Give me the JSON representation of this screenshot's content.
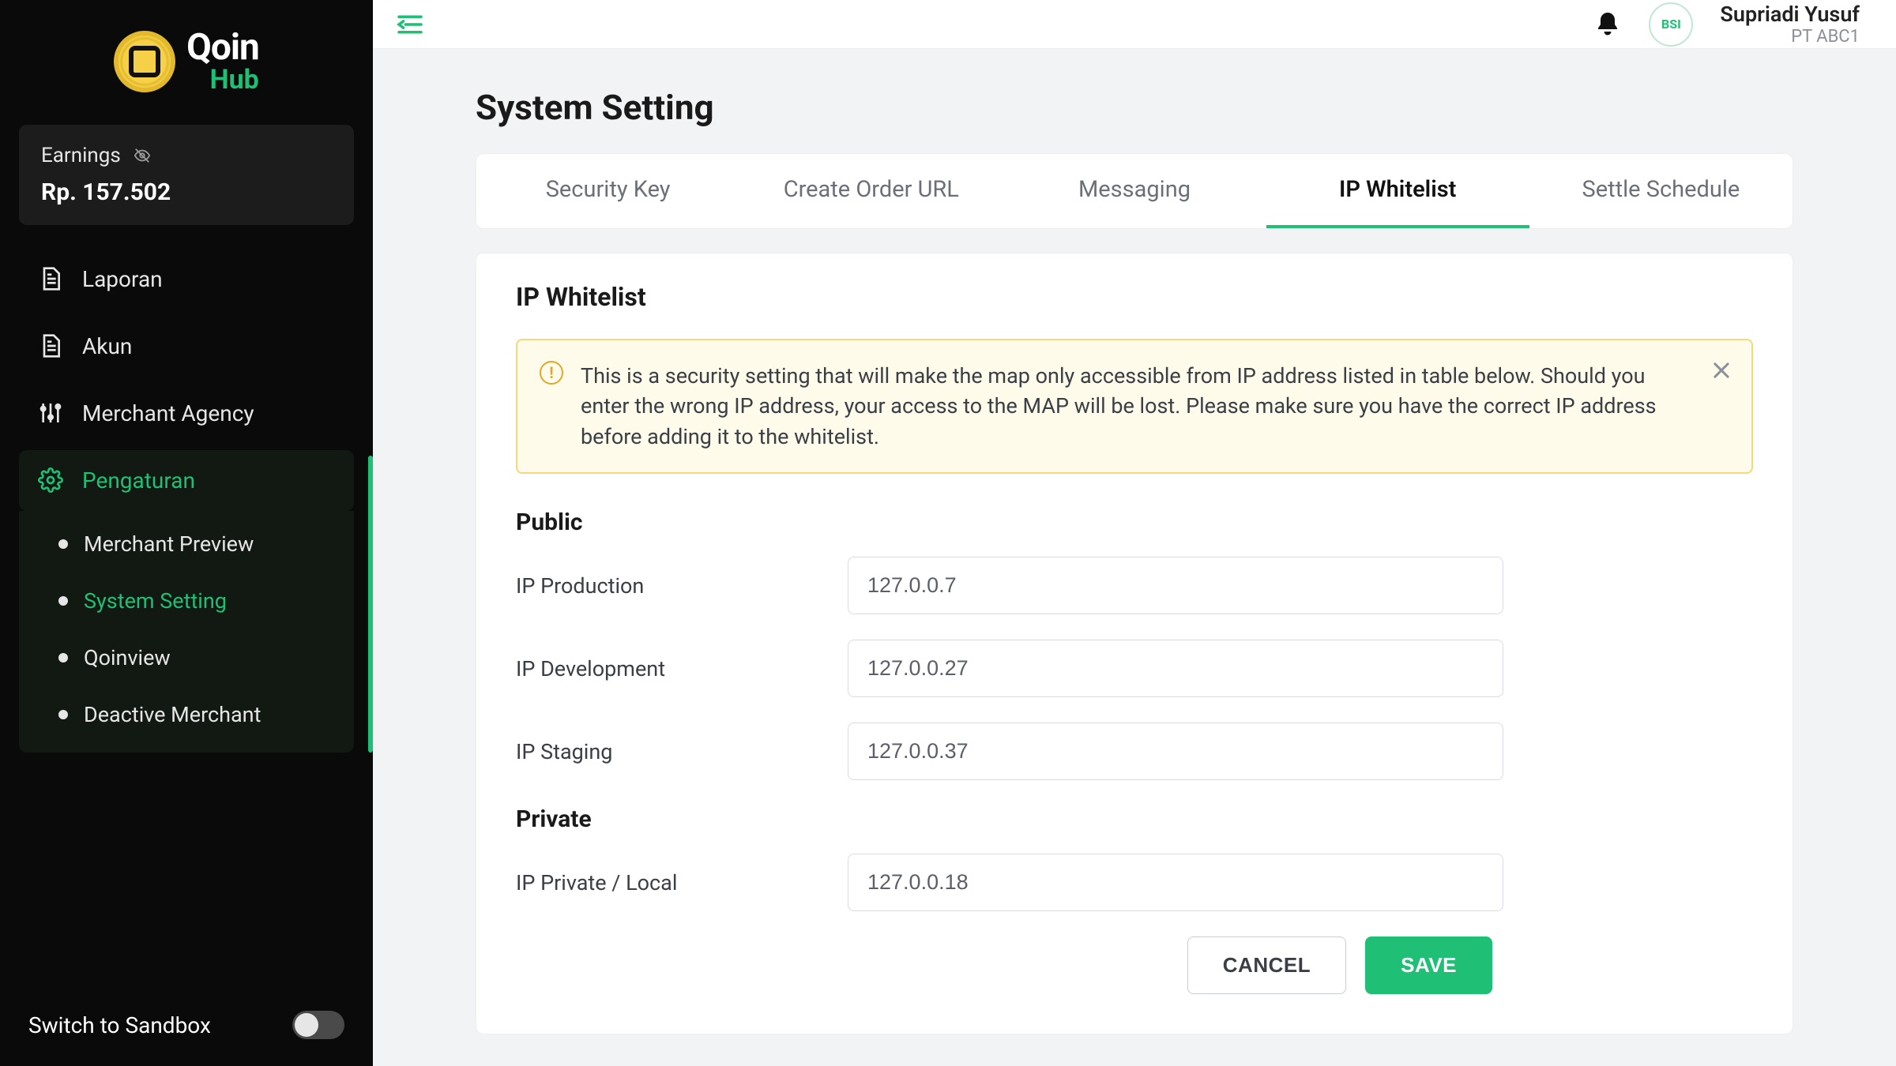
{
  "brand": {
    "line1": "Qoin",
    "line2": "Hub"
  },
  "earnings": {
    "label": "Earnings",
    "value": "Rp. 157.502"
  },
  "nav": {
    "laporan": "Laporan",
    "akun": "Akun",
    "merchant_agency": "Merchant Agency",
    "pengaturan": "Pengaturan"
  },
  "subnav": {
    "merchant_preview": "Merchant Preview",
    "system_setting": "System Setting",
    "qoinview": "Qoinview",
    "deactive_merchant": "Deactive Merchant"
  },
  "sandbox_label": "Switch to Sandbox",
  "user": {
    "name": "Supriadi Yusuf",
    "org": "PT ABC1",
    "avatar_text": "BSI"
  },
  "page_title": "System Setting",
  "tabs": {
    "security_key": "Security Key",
    "create_order_url": "Create Order URL",
    "messaging": "Messaging",
    "ip_whitelist": "IP Whitelist",
    "settle_schedule": "Settle Schedule"
  },
  "panel_title": "IP Whitelist",
  "alert_text": "This is a security setting that will make the map only accessible from IP address listed in table below. Should you enter the wrong IP address, your access to the MAP will be lost. Please make sure you have the correct IP address before adding it to the whitelist.",
  "sections": {
    "public": "Public",
    "private": "Private"
  },
  "fields": {
    "ip_production": {
      "label": "IP Production",
      "value": "127.0.0.7"
    },
    "ip_development": {
      "label": "IP Development",
      "value": "127.0.0.27"
    },
    "ip_staging": {
      "label": "IP Staging",
      "value": "127.0.0.37"
    },
    "ip_private": {
      "label": "IP Private / Local",
      "value": "127.0.0.18"
    }
  },
  "actions": {
    "cancel": "CANCEL",
    "save": "SAVE"
  }
}
